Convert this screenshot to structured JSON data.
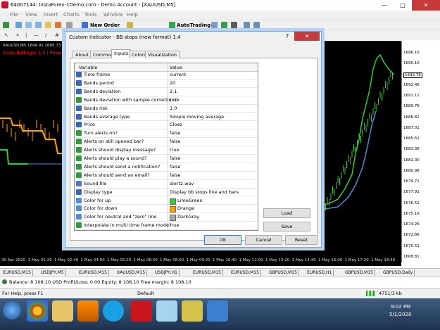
{
  "window": {
    "title": "64007144: InstaForex-1Demo.com - Demo Account - [XAUUSD,M5]",
    "minimize": "—",
    "maximize": "□",
    "close": "✕"
  },
  "menu": [
    "File",
    "View",
    "Insert",
    "Charts",
    "Tools",
    "Window",
    "Help"
  ],
  "toolbar": {
    "new_order": "New Order",
    "autotrading": "AutoTrading"
  },
  "chart": {
    "symbol_label": "XAUUSD,M5  1694.91 1695.73 1",
    "indicator_label": "Dada-Bollinger 1.0 | Powe",
    "price_labels": [
      "1696.15",
      "1695.10",
      "1693.78",
      "1692.46",
      "1691.11",
      "1689.76",
      "1688.81",
      "1687.01",
      "1685.61",
      "1683.36",
      "1682.00",
      "1680.98",
      "1679.71",
      "1677.91",
      "1676.51",
      "1675.16",
      "1674.26",
      "1672.86",
      "1670.51",
      "1668.81"
    ],
    "highlighted_price": "1693.78",
    "time_labels": [
      "30 Apr 2020",
      "1 May 01:20",
      "1 May 02:40",
      "1 May 04:00",
      "1 May 05:20",
      "1 May 06:40",
      "1 May 08:00",
      "1 May 09:20",
      "1 May 10:40",
      "1 May 12:00",
      "1 May 13:20",
      "1 May 14:40",
      "1 May 16:00",
      "1 May 17:20",
      "1 May 18:40"
    ]
  },
  "dialog": {
    "title": "Custom Indicator - BB stops (new format) 1.4",
    "help": "?",
    "close": "✕",
    "tabs": [
      "About",
      "Common",
      "Inputs",
      "Colors",
      "Visualization"
    ],
    "active_tab": "Inputs",
    "grid": {
      "col_variable": "Variable",
      "col_value": "Value",
      "rows": [
        {
          "icon": "num",
          "variable": "Time frame",
          "value": "current"
        },
        {
          "icon": "num",
          "variable": "Bands period",
          "value": "20"
        },
        {
          "icon": "num",
          "variable": "Bands deviation",
          "value": "2.1"
        },
        {
          "icon": "bool",
          "variable": "Bands deviation with sample correction?",
          "value": "true"
        },
        {
          "icon": "num",
          "variable": "Bands risk",
          "value": "1.0"
        },
        {
          "icon": "num",
          "variable": "Bands average type",
          "value": "Simple moving average"
        },
        {
          "icon": "num",
          "variable": "Price",
          "value": "Close"
        },
        {
          "icon": "bool",
          "variable": "Turn alerts on?",
          "value": "false"
        },
        {
          "icon": "bool",
          "variable": "Alerts on still opened bar?",
          "value": "false"
        },
        {
          "icon": "bool",
          "variable": "Alerts should display message?",
          "value": "true"
        },
        {
          "icon": "bool",
          "variable": "Alerts should play a sound?",
          "value": "false"
        },
        {
          "icon": "bool",
          "variable": "Alerts should send a notification?",
          "value": "false"
        },
        {
          "icon": "bool",
          "variable": "Alerts should send an email?",
          "value": "false"
        },
        {
          "icon": "txt",
          "variable": "Sound file",
          "value": "alert2.wav"
        },
        {
          "icon": "num",
          "variable": "Display type",
          "value": "Display bb stops line and bars"
        },
        {
          "icon": "col",
          "variable": "Color for up",
          "value": "LimeGreen",
          "swatch": "#32cd32"
        },
        {
          "icon": "col",
          "variable": "Color for down",
          "value": "Orange",
          "swatch": "#ffa500"
        },
        {
          "icon": "col",
          "variable": "Color for neutral and \"zero\" line",
          "value": "DarkGray",
          "swatch": "#a9a9a9"
        },
        {
          "icon": "bool",
          "variable": "Interpolate in multi time frame mode?",
          "value": "true"
        }
      ]
    },
    "buttons": {
      "load": "Load",
      "save": "Save",
      "ok": "OK",
      "cancel": "Cancel",
      "reset": "Reset"
    }
  },
  "symbol_tabs": [
    "EURUSD,M15",
    "USDJPY,M5",
    "EURUSD,M15",
    "XAUUSD,M15",
    "USDJPY,H1",
    "EURUSD,M15",
    "EURUSD,M15",
    "GBPUSD,M15",
    "EURUSD,H1",
    "GBPUSD,M15",
    "GBPUSD,Daily"
  ],
  "terminal": {
    "balance": "Balance: 8 108.10 USD  Profit/Loss: 0.00  Equity: 8 108.10  Free margin: 8 108.10"
  },
  "statusbar": {
    "help": "For Help, press F1",
    "profile": "Default",
    "traffic": "4751/3 kb"
  },
  "taskbar": {
    "time": "9:02 PM",
    "date": "5/1/2020"
  },
  "colors": {
    "up": "#32cd32",
    "down": "#ffa500",
    "neutral": "#a9a9a9",
    "chart_bg": "#000000"
  }
}
